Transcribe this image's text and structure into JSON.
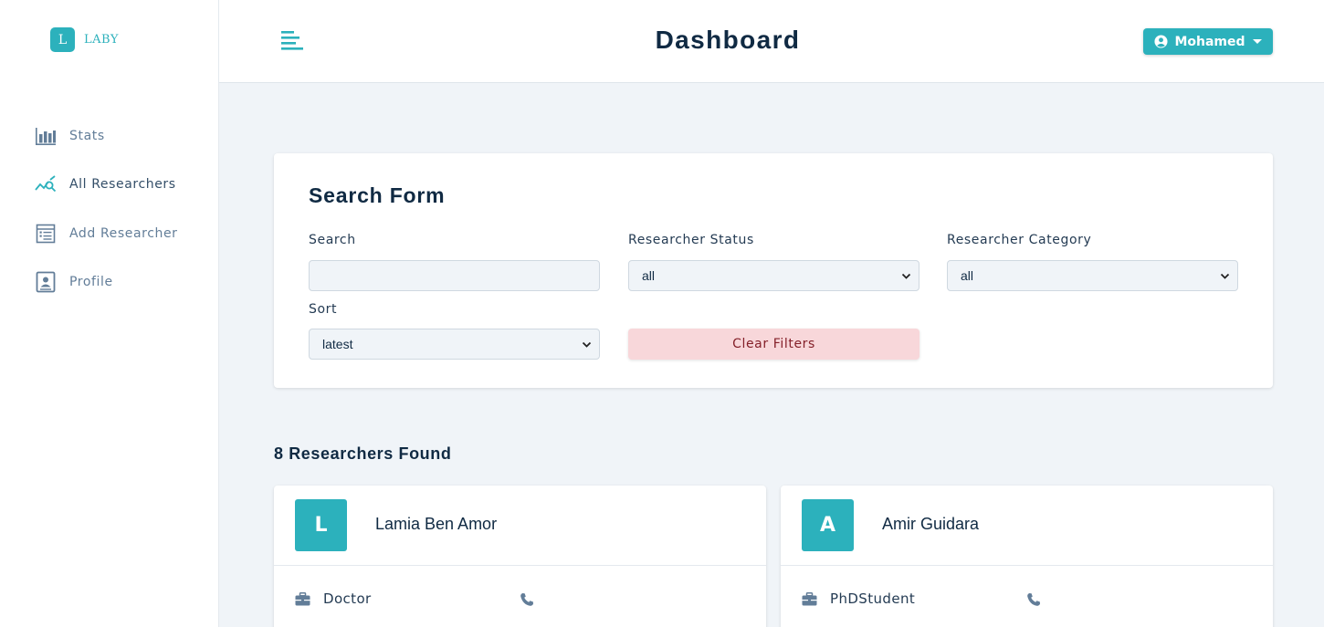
{
  "brand": {
    "logo_letter": "L",
    "name": "LABY"
  },
  "sidebar": {
    "items": [
      {
        "label": "Stats",
        "icon": "bar-chart-icon"
      },
      {
        "label": "All Researchers",
        "icon": "query-stats-icon",
        "active": true
      },
      {
        "label": "Add Researcher",
        "icon": "form-icon"
      },
      {
        "label": "Profile",
        "icon": "id-card-icon"
      }
    ]
  },
  "header": {
    "title": "Dashboard",
    "user_name": "Mohamed"
  },
  "search_form": {
    "title": "Search Form",
    "search_label": "Search",
    "search_value": "",
    "status_label": "Researcher Status",
    "status_value": "all",
    "category_label": "Researcher Category",
    "category_value": "all",
    "sort_label": "Sort",
    "sort_value": "latest",
    "clear_label": "Clear Filters"
  },
  "results": {
    "count_text": "8 Researchers Found",
    "cards": [
      {
        "initial": "L",
        "name": "Lamia Ben Amor",
        "category": "Doctor"
      },
      {
        "initial": "A",
        "name": "Amir Guidara",
        "category": "PhDStudent"
      }
    ]
  },
  "colors": {
    "accent": "#2cb1bc",
    "danger_bg": "#f8d7da",
    "danger_text": "#842029",
    "page_bg": "#f0f4f8"
  }
}
